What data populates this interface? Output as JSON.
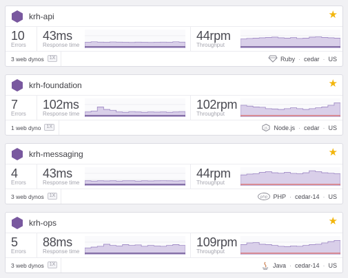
{
  "apps": [
    {
      "name": "krh-api",
      "starred": true,
      "errors": "10",
      "errors_label": "Errors",
      "response_time": "43ms",
      "response_label": "Response time",
      "throughput": "44rpm",
      "throughput_label": "Throughput",
      "dynos": "3 web dynos",
      "dyno_size": "1X",
      "language": "Ruby",
      "language_icon": "ruby-icon",
      "stack": "cedar",
      "region": "US",
      "response_spark": [
        0.35,
        0.38,
        0.36,
        0.35,
        0.37,
        0.36,
        0.35,
        0.34,
        0.36,
        0.35,
        0.34,
        0.35,
        0.36,
        0.35,
        0.38,
        0.36
      ],
      "throughput_spark": [
        0.55,
        0.58,
        0.6,
        0.62,
        0.64,
        0.66,
        0.62,
        0.6,
        0.63,
        0.58,
        0.6,
        0.66,
        0.68,
        0.64,
        0.62,
        0.6
      ]
    },
    {
      "name": "krh-foundation",
      "starred": true,
      "errors": "7",
      "errors_label": "Errors",
      "response_time": "102ms",
      "response_label": "Response time",
      "throughput": "102rpm",
      "throughput_label": "Throughput",
      "dynos": "1 web dyno",
      "dyno_size": "1X",
      "language": "Node.js",
      "language_icon": "nodejs-icon",
      "stack": "cedar",
      "region": "US",
      "response_spark": [
        0.3,
        0.35,
        0.6,
        0.45,
        0.4,
        0.3,
        0.28,
        0.32,
        0.3,
        0.28,
        0.3,
        0.29,
        0.3,
        0.28,
        0.3,
        0.32
      ],
      "throughput_spark": [
        0.7,
        0.65,
        0.6,
        0.58,
        0.5,
        0.48,
        0.45,
        0.5,
        0.55,
        0.5,
        0.45,
        0.5,
        0.55,
        0.6,
        0.7,
        0.85
      ]
    },
    {
      "name": "krh-messaging",
      "starred": true,
      "errors": "4",
      "errors_label": "Errors",
      "response_time": "43ms",
      "response_label": "Response time",
      "throughput": "44rpm",
      "throughput_label": "Throughput",
      "dynos": "3 web dynos",
      "dyno_size": "1X",
      "language": "PHP",
      "language_icon": "php-icon",
      "stack": "cedar-14",
      "region": "US",
      "response_spark": [
        0.3,
        0.28,
        0.3,
        0.29,
        0.3,
        0.28,
        0.3,
        0.3,
        0.28,
        0.3,
        0.29,
        0.3,
        0.31,
        0.3,
        0.29,
        0.3
      ],
      "throughput_spark": [
        0.65,
        0.7,
        0.72,
        0.8,
        0.85,
        0.78,
        0.75,
        0.8,
        0.74,
        0.72,
        0.78,
        0.9,
        0.85,
        0.78,
        0.75,
        0.72
      ]
    },
    {
      "name": "krh-ops",
      "starred": true,
      "errors": "5",
      "errors_label": "Errors",
      "response_time": "88ms",
      "response_label": "Response time",
      "throughput": "109rpm",
      "throughput_label": "Throughput",
      "dynos": "3 web dynos",
      "dyno_size": "1X",
      "language": "Java",
      "language_icon": "java-icon",
      "stack": "cedar-14",
      "region": "US",
      "response_spark": [
        0.4,
        0.45,
        0.5,
        0.62,
        0.55,
        0.52,
        0.6,
        0.55,
        0.58,
        0.5,
        0.55,
        0.52,
        0.5,
        0.55,
        0.6,
        0.55
      ],
      "throughput_spark": [
        0.6,
        0.7,
        0.72,
        0.62,
        0.6,
        0.55,
        0.5,
        0.48,
        0.52,
        0.5,
        0.55,
        0.6,
        0.62,
        0.7,
        0.78,
        0.85
      ]
    }
  ],
  "colors": {
    "accent": "#79589f",
    "spark_fill": "#d9cfe9",
    "spark_line": "#9c86c3",
    "spark_base": "#6f5796",
    "star": "#f2b50c",
    "error_line": "#d9534f"
  }
}
